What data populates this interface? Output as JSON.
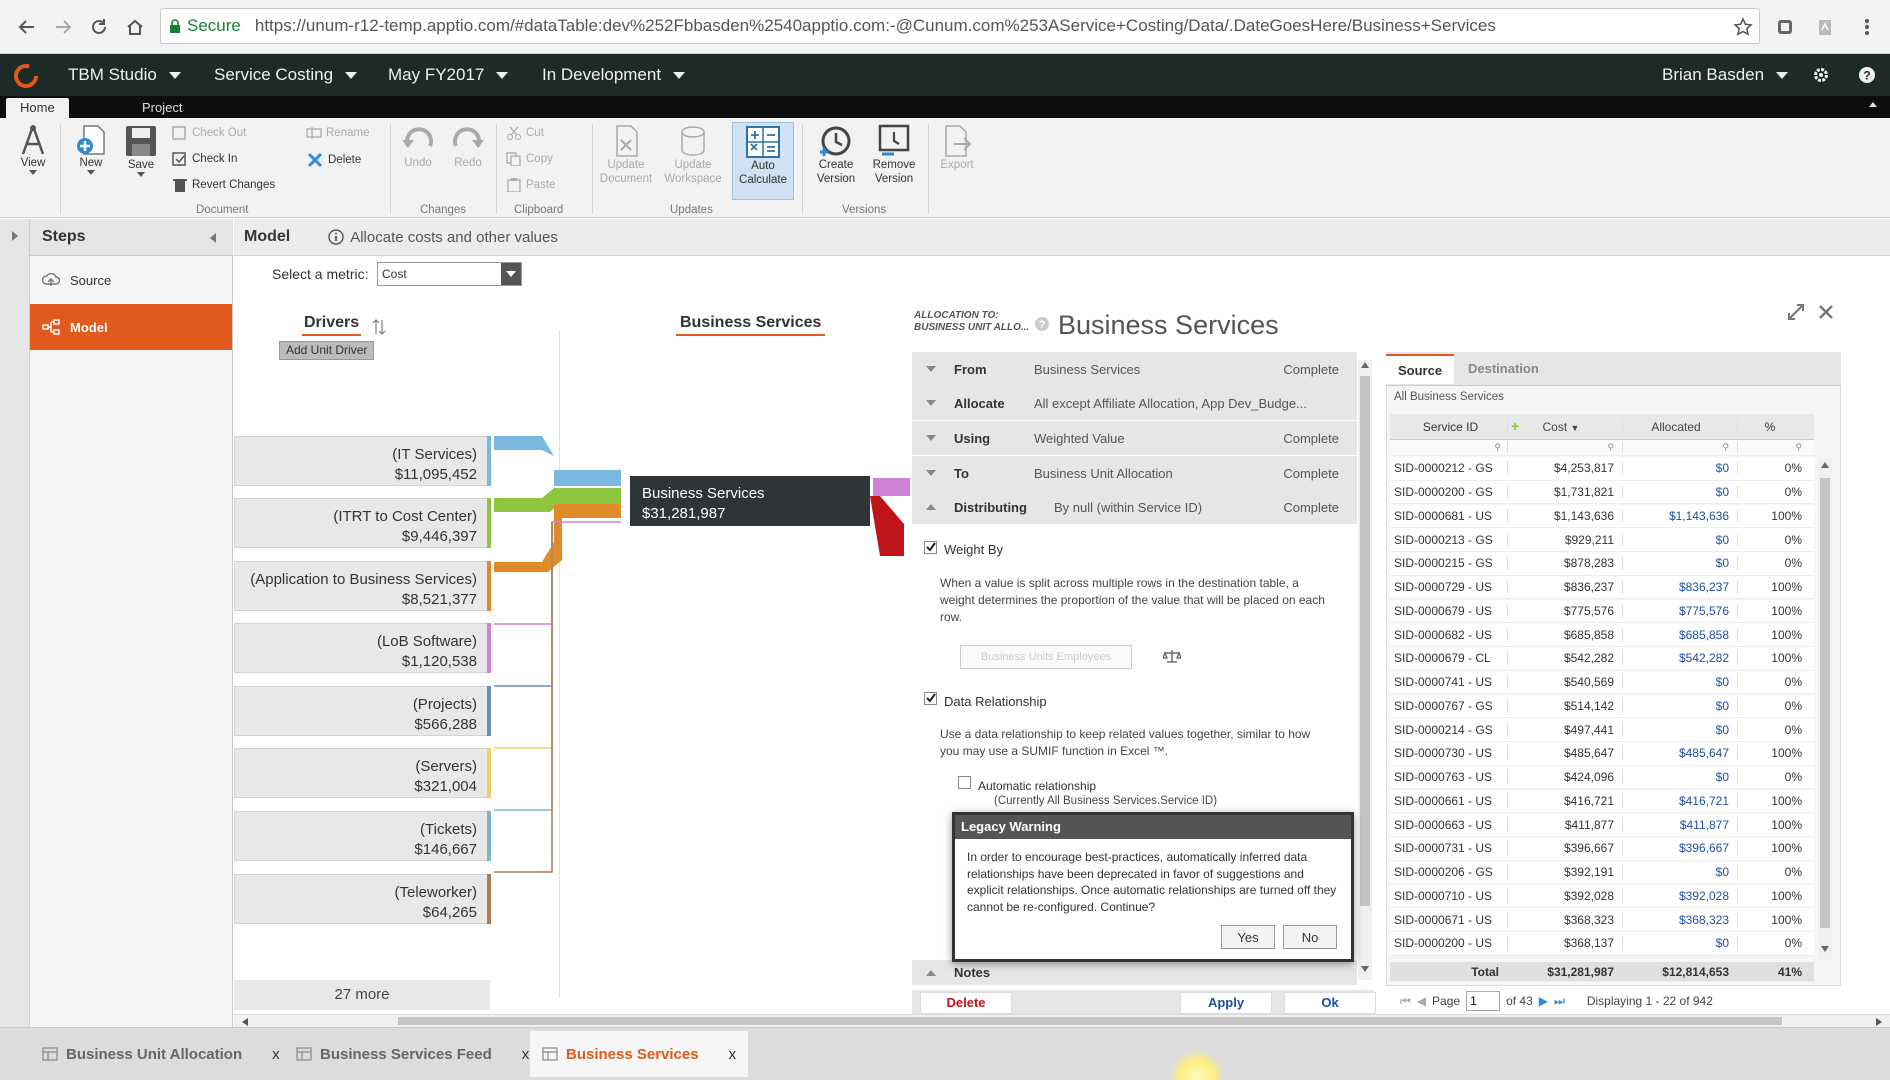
{
  "browser": {
    "secure_label": "Secure",
    "url": "https://unum-r12-temp.apptio.com/#dataTable:dev%252Fbbasden%2540apptio.com:-@Cunum.com%253AService+Costing/Data/.DateGoesHere/Business+Services"
  },
  "header": {
    "menus": [
      "TBM Studio",
      "Service Costing",
      "May FY2017",
      "In Development"
    ],
    "user": "Brian Basden"
  },
  "ribbon": {
    "tabs": [
      "Home",
      "Project"
    ],
    "view": "View",
    "new": "New",
    "save": "Save",
    "check_out": "Check Out",
    "check_in": "Check In",
    "revert": "Revert Changes",
    "rename": "Rename",
    "delete": "Delete",
    "undo": "Undo",
    "redo": "Redo",
    "cut": "Cut",
    "copy": "Copy",
    "paste": "Paste",
    "update_document": [
      "Update",
      "Document"
    ],
    "update_workspace": [
      "Update",
      "Workspace"
    ],
    "auto_calculate": [
      "Auto",
      "Calculate"
    ],
    "create_version": [
      "Create",
      "Version"
    ],
    "remove_version": [
      "Remove",
      "Version"
    ],
    "export": "Export",
    "groups": [
      "Document",
      "Changes",
      "Clipboard",
      "Updates",
      "Versions"
    ]
  },
  "steps": {
    "title": "Steps",
    "items": [
      "Source",
      "Model"
    ]
  },
  "model": {
    "title": "Model",
    "info": "Allocate costs and other values",
    "metric_label": "Select a metric:",
    "metric_value": "Cost"
  },
  "drivers": {
    "title": "Drivers",
    "add_button": "Add Unit Driver",
    "more": "27 more",
    "items": [
      {
        "name": "(IT Services)",
        "value": "$11,095,452",
        "color": "#7ab8e0"
      },
      {
        "name": "(ITRT to Cost Center)",
        "value": "$9,446,397",
        "color": "#8cc63f"
      },
      {
        "name": "(Application to Business Services)",
        "value": "$8,521,377",
        "color": "#e08a2a"
      },
      {
        "name": "(LoB Software)",
        "value": "$1,120,538",
        "color": "#d082d8"
      },
      {
        "name": "(Projects)",
        "value": "$566,288",
        "color": "#6a8fb5"
      },
      {
        "name": "(Servers)",
        "value": "$321,004",
        "color": "#f0d060"
      },
      {
        "name": "(Tickets)",
        "value": "$146,667",
        "color": "#7ab8c8"
      },
      {
        "name": "(Teleworker)",
        "value": "$64,265",
        "color": "#b07a50"
      }
    ]
  },
  "target": {
    "column_title": "Business Services",
    "node_name": "Business Services",
    "node_value": "$31,281,987"
  },
  "allocation": {
    "to_label": [
      "ALLOCATION TO:",
      "BUSINESS UNIT ALLO..."
    ],
    "title": "Business Services",
    "rows": [
      {
        "label": "From",
        "value": "Business Services",
        "status": "Complete"
      },
      {
        "label": "Allocate",
        "value": "All except Affiliate Allocation, App Dev_Budge...",
        "status": ""
      },
      {
        "label": "Using",
        "value": "Weighted Value",
        "status": "Complete"
      },
      {
        "label": "To",
        "value": "Business Unit Allocation",
        "status": "Complete"
      },
      {
        "label": "Distributing",
        "value": "By null (within Service ID)",
        "status": "Complete"
      }
    ],
    "weight_by_label": "Weight By",
    "weight_by_desc": "When a value is split across multiple rows in the destination table, a weight determines the proportion of the value that will be placed on each row.",
    "weight_field": "Business Units Employees",
    "data_rel_label": "Data Relationship",
    "data_rel_desc": "Use a data relationship to keep related values together, similar to how you may use a SUMIF function in Excel ™.",
    "auto_rel_label": "Automatic relationship",
    "auto_rel_sub": "(Currently All Business Services.Service ID)",
    "notes_label": "Notes",
    "delete_button": "Delete",
    "apply_button": "Apply",
    "ok_button": "Ok"
  },
  "dialog": {
    "title": "Legacy Warning",
    "body": "In order to encourage best-practices, automatically inferred data relationships have been deprecated in favor of suggestions and explicit relationships. Once automatic relationships are turned off they cannot be re-configured. Continue?",
    "yes": "Yes",
    "no": "No"
  },
  "grid": {
    "tabs": [
      "Source",
      "Destination"
    ],
    "subtitle": "All Business Services",
    "headers": [
      "Service ID",
      "Cost",
      "Allocated",
      "%"
    ],
    "rows": [
      [
        "SID-0000212 - GS",
        "$4,253,817",
        "$0",
        "0%"
      ],
      [
        "SID-0000200 - GS",
        "$1,731,821",
        "$0",
        "0%"
      ],
      [
        "SID-0000681 - US",
        "$1,143,636",
        "$1,143,636",
        "100%"
      ],
      [
        "SID-0000213 - GS",
        "$929,211",
        "$0",
        "0%"
      ],
      [
        "SID-0000215 - GS",
        "$878,283",
        "$0",
        "0%"
      ],
      [
        "SID-0000729 - US",
        "$836,237",
        "$836,237",
        "100%"
      ],
      [
        "SID-0000679 - US",
        "$775,576",
        "$775,576",
        "100%"
      ],
      [
        "SID-0000682 - US",
        "$685,858",
        "$685,858",
        "100%"
      ],
      [
        "SID-0000679 - CL",
        "$542,282",
        "$542,282",
        "100%"
      ],
      [
        "SID-0000741 - US",
        "$540,569",
        "$0",
        "0%"
      ],
      [
        "SID-0000767 - GS",
        "$514,142",
        "$0",
        "0%"
      ],
      [
        "SID-0000214 - GS",
        "$497,441",
        "$0",
        "0%"
      ],
      [
        "SID-0000730 - US",
        "$485,647",
        "$485,647",
        "100%"
      ],
      [
        "SID-0000763 - US",
        "$424,096",
        "$0",
        "0%"
      ],
      [
        "SID-0000661 - US",
        "$416,721",
        "$416,721",
        "100%"
      ],
      [
        "SID-0000663 - US",
        "$411,877",
        "$411,877",
        "100%"
      ],
      [
        "SID-0000731 - US",
        "$396,667",
        "$396,667",
        "100%"
      ],
      [
        "SID-0000206 - GS",
        "$392,191",
        "$0",
        "0%"
      ],
      [
        "SID-0000710 - US",
        "$392,028",
        "$392,028",
        "100%"
      ],
      [
        "SID-0000671 - US",
        "$368,323",
        "$368,323",
        "100%"
      ],
      [
        "SID-0000200 - US",
        "$368,137",
        "$0",
        "0%"
      ]
    ],
    "total": [
      "Total",
      "$31,281,987",
      "$12,814,653",
      "41%"
    ],
    "page_label": "Page",
    "page_value": "1",
    "page_of": "of 43",
    "displaying": "Displaying 1 - 22 of 942"
  },
  "bottom_tabs": [
    {
      "label": "Business Unit Allocation",
      "active": false
    },
    {
      "label": "Business Services Feed",
      "active": false
    },
    {
      "label": "Business Services",
      "active": true
    }
  ],
  "colors": {
    "accent": "#e05a1e",
    "header_bg": "#1e2a26",
    "link_blue": "#1f4fa8"
  }
}
